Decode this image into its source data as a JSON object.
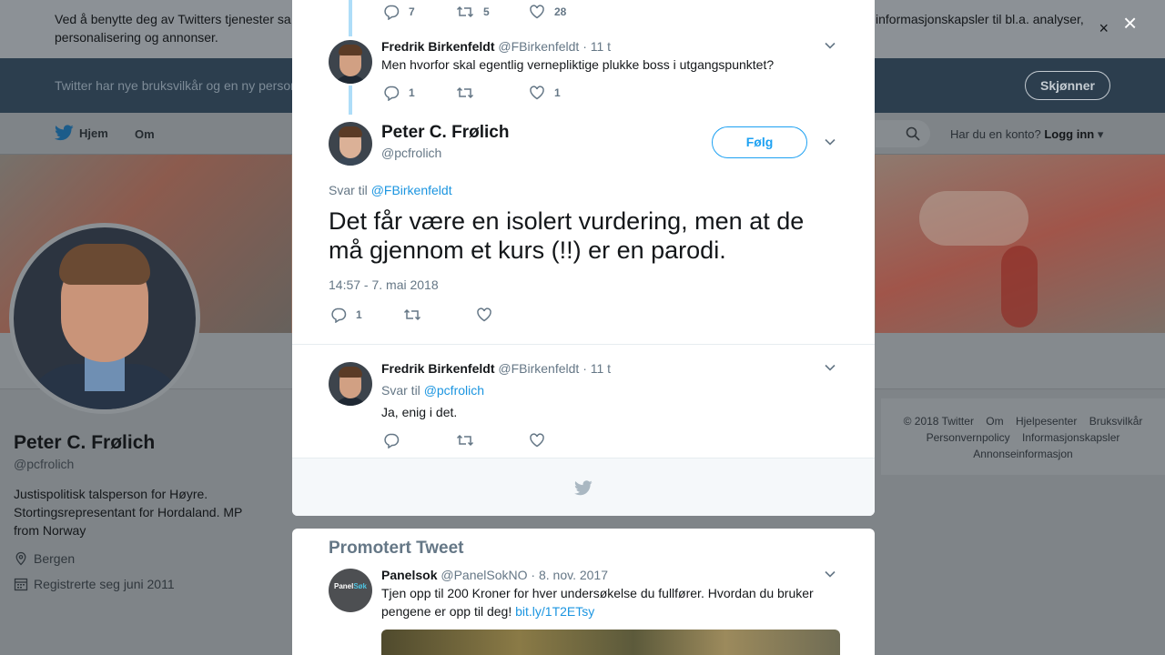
{
  "cookie_bar": {
    "text": "Ved å benytte deg av Twitters tjenester sa",
    "text_right": "informasjonskapsler til bl.a. analyser,",
    "text2": "personalisering og annonser.",
    "close": "×"
  },
  "terms_bar": {
    "text": "Twitter har nye bruksvilkår og en ny person",
    "button": "Skjønner"
  },
  "nav": {
    "home": "Hjem",
    "about": "Om",
    "account_prompt": "Har du en konto?",
    "login": "Logg inn"
  },
  "profile": {
    "name": "Peter C. Frølich",
    "handle": "@pcfrolich",
    "bio": "Justispolitisk talsperson for Høyre. Stortingsrepresentant for Hordaland. MP from Norway",
    "location": "Bergen",
    "joined": "Registrerte seg juni 2011"
  },
  "footer": {
    "links": [
      "© 2018 Twitter",
      "Om",
      "Hjelpesenter",
      "Bruksvilkår",
      "Personvernpolicy",
      "Informasjonskapsler",
      "Annonseinformasjon"
    ]
  },
  "modal_close": "×",
  "thread": {
    "top_actions": {
      "replies": "7",
      "retweets": "5",
      "likes": "28"
    },
    "prev_tweet": {
      "name": "Fredrik Birkenfeldt",
      "handle": "@FBirkenfeldt",
      "time": "· 11 t",
      "text": "Men hvorfor skal egentlig vernepliktige plukke boss i utgangspunktet?",
      "replies": "1",
      "likes": "1"
    },
    "main_tweet": {
      "name": "Peter C. Frølich",
      "handle": "@pcfrolich",
      "follow": "Følg",
      "reply_prefix": "Svar til",
      "reply_to": "@FBirkenfeldt",
      "text": "Det får være en isolert vurdering, men at de må gjennom et kurs (!!) er en parodi.",
      "timestamp": "14:57 - 7. mai 2018",
      "replies": "1"
    },
    "reply_tweet": {
      "name": "Fredrik Birkenfeldt",
      "handle": "@FBirkenfeldt",
      "time": "· 11 t",
      "reply_prefix": "Svar til",
      "reply_to": "@pcfrolich",
      "text": "Ja, enig i det."
    }
  },
  "promoted": {
    "title": "Promotert Tweet",
    "name": "Panelsok",
    "handle": "@PanelSokNO",
    "time": "· 8. nov. 2017",
    "text": "Tjen opp til 200 Kroner for hver undersøkelse du fullfører. Hvordan du bruker pengene er opp til deg!",
    "link": "bit.ly/1T2ETsy",
    "logo_a": "Panel",
    "logo_b": "Søk"
  },
  "colors": {
    "accent": "#1da1f2",
    "link": "#1b95e0",
    "muted": "#657786",
    "thread_line": "#aeddf8"
  }
}
